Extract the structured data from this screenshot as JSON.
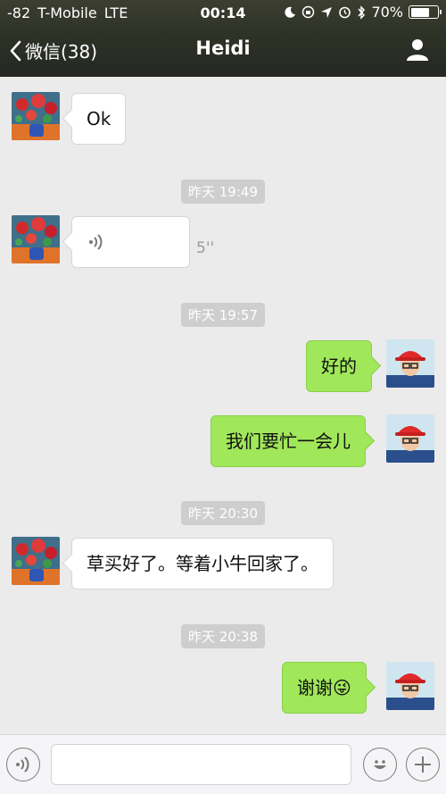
{
  "status": {
    "signal": "-82",
    "carrier": "T-Mobile",
    "network": "LTE",
    "time": "00:14",
    "battery": "70%",
    "battery_level": 0.7
  },
  "nav": {
    "back_label": "微信(38)",
    "title": "Heidi"
  },
  "messages": [
    {
      "side": "left",
      "text": "Ok"
    },
    {
      "timestamp": "昨天 19:49"
    },
    {
      "side": "left",
      "type": "voice",
      "duration": "5''"
    },
    {
      "timestamp": "昨天 19:57"
    },
    {
      "side": "right",
      "text": "好的"
    },
    {
      "side": "right",
      "text": "我们要忙一会儿"
    },
    {
      "timestamp": "昨天 20:30"
    },
    {
      "side": "left",
      "text": "草买好了。等着小牛回家了。"
    },
    {
      "timestamp": "昨天 20:38"
    },
    {
      "side": "right",
      "text": "谢谢😜"
    }
  ],
  "colors": {
    "header": "#2c3025",
    "chat_bg": "#ebebeb",
    "bubble_self": "#a0e75a",
    "bubble_other": "#ffffff"
  }
}
